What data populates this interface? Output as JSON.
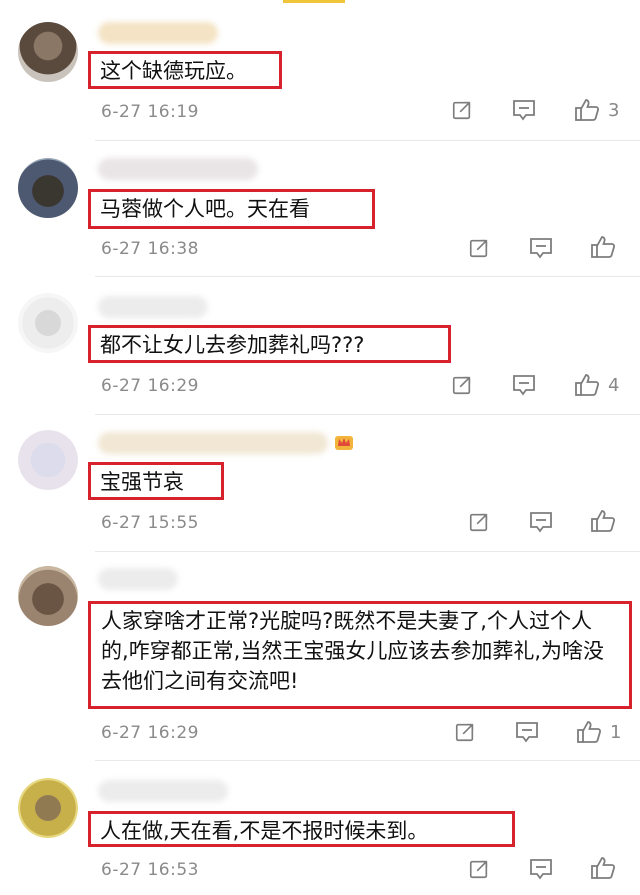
{
  "colors": {
    "highlight_border": "#d6222d",
    "meta_text": "#8a8a8a",
    "icon": "#7d7d7d",
    "accent": "#f0c53a"
  },
  "icons": {
    "share": "share-icon",
    "reply": "reply-icon",
    "like": "thumbs-up-icon"
  },
  "comments": [
    {
      "text": "这个缺德玩应。",
      "time": "6-27 16:19",
      "likes": "3"
    },
    {
      "text": "马蓉做个人吧。天在看",
      "time": "6-27 16:38",
      "likes": ""
    },
    {
      "text": "都不让女儿去参加葬礼吗???",
      "time": "6-27 16:29",
      "likes": "4"
    },
    {
      "text": "宝强节哀",
      "time": "6-27 15:55",
      "likes": ""
    },
    {
      "text": "人家穿啥才正常?光腚吗?既然不是夫妻了,个人过个人的,咋穿都正常,当然王宝强女儿应该去参加葬礼,为啥没去他们之间有交流吧!",
      "time": "6-27 16:29",
      "likes": "1"
    },
    {
      "text": "人在做,天在看,不是不报时候未到。",
      "time": "6-27 16:53",
      "likes": ""
    }
  ]
}
